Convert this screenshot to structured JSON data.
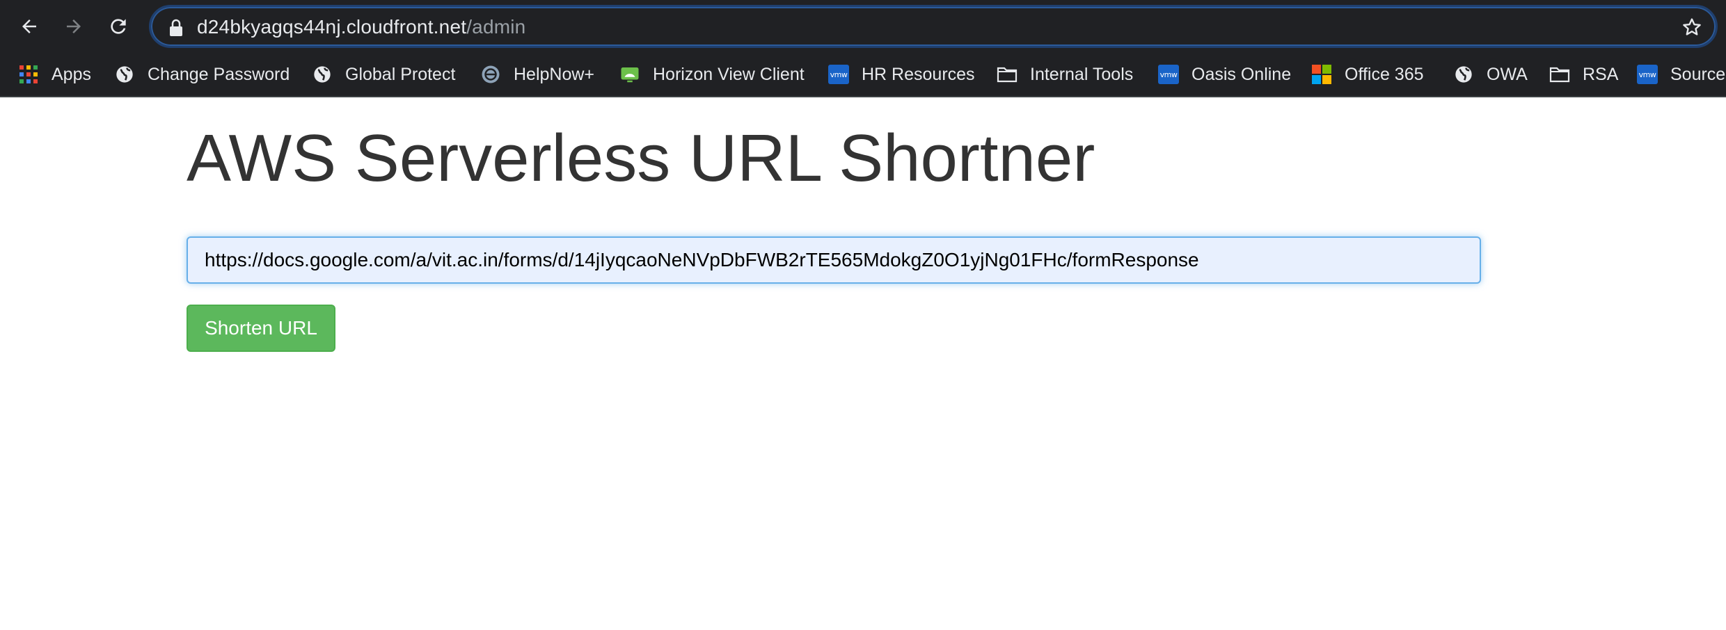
{
  "browser": {
    "url_host": "d24bkyagqs44nj.cloudfront.net",
    "url_path": "/admin",
    "icons": {
      "back": "arrow-left-icon",
      "forward": "arrow-right-icon",
      "reload": "reload-icon",
      "lock": "lock-icon",
      "bookmark_star": "star-icon"
    }
  },
  "bookmarks": [
    {
      "label": "Apps",
      "icon": "apps-grid-icon"
    },
    {
      "label": "Change Password",
      "icon": "globe-icon"
    },
    {
      "label": "Global Protect",
      "icon": "globe-icon"
    },
    {
      "label": "HelpNow+",
      "icon": "helpnow-icon"
    },
    {
      "label": "Horizon View Client",
      "icon": "horizon-icon"
    },
    {
      "label": "HR Resources",
      "icon": "vmw-icon"
    },
    {
      "label": "Internal Tools",
      "icon": "folder-icon"
    },
    {
      "label": "Oasis Online",
      "icon": "vmw-icon"
    },
    {
      "label": "Office 365",
      "icon": "microsoft-icon"
    },
    {
      "label": "OWA",
      "icon": "globe-icon"
    },
    {
      "label": "RSA",
      "icon": "folder-icon"
    },
    {
      "label": "Source",
      "icon": "vmw-icon"
    }
  ],
  "vmw_badge": "vmw",
  "page": {
    "title": "AWS Serverless URL Shortner",
    "url_input_value": "https://docs.google.com/a/vit.ac.in/forms/d/14jIyqcaoNeNVpDbFWB2rTE565MdokgZ0O1yjNg01FHc/formResponse",
    "shorten_button_label": "Shorten URL"
  },
  "colors": {
    "chrome_bg": "#202124",
    "button_green": "#5cb85c",
    "input_focus_border": "#66afe9",
    "input_autofill_bg": "#e8f0fe"
  }
}
